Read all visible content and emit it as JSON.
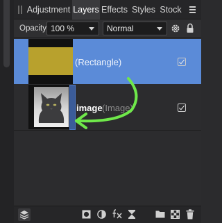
{
  "tabs": [
    {
      "label": "Adjustment",
      "active": false
    },
    {
      "label": "Layers",
      "active": true
    },
    {
      "label": "Effects",
      "active": false
    },
    {
      "label": "Styles",
      "active": false
    },
    {
      "label": "Stock",
      "active": false
    }
  ],
  "options": {
    "opacity_label": "Opacity:",
    "opacity_value": "100 %",
    "blend_mode": "Normal"
  },
  "layers": [
    {
      "name": "",
      "type": "(Rectangle)",
      "thumb_color": "#b8a12d",
      "visible": true,
      "selected": true
    },
    {
      "name": "image",
      "type": "(Image)",
      "visible": true,
      "selected": false
    }
  ],
  "colors": {
    "selection": "#5b8bd8",
    "annotation_arrow": "#6fe84a"
  },
  "icons": {
    "panel_menu": "hamburger-menu-icon",
    "settings": "gear-icon",
    "lock": "lock-icon",
    "layer_stack": "layers-stack-icon",
    "mask": "mask-icon",
    "adjustment": "adjustment-circle-icon",
    "fx": "fx-icon",
    "live_filter": "hourglass-filter-icon",
    "group": "folder-icon",
    "pixel_layer": "checker-pixel-icon",
    "delete": "trash-icon"
  }
}
